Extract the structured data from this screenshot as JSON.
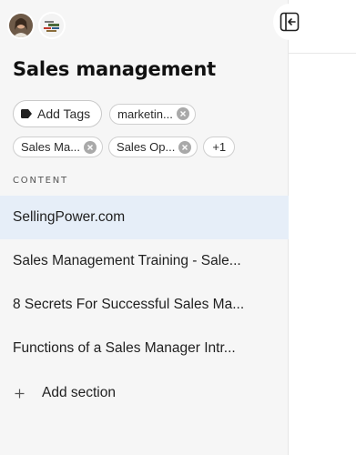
{
  "header": {
    "title": "Sales management"
  },
  "avatars": [
    {
      "icon": "user-avatar"
    },
    {
      "icon": "word-cloud-avatar"
    }
  ],
  "toolbar": {
    "collapse_icon": "collapse-sidebar-icon"
  },
  "tags": {
    "add_label": "Add Tags",
    "items": [
      {
        "label": "marketin..."
      },
      {
        "label": "Sales Ma..."
      },
      {
        "label": "Sales Op..."
      }
    ],
    "more_label": "+1"
  },
  "content": {
    "section_label": "CONTENT",
    "items": [
      {
        "label": "SellingPower.com"
      },
      {
        "label": "Sales Management Training - Sale..."
      },
      {
        "label": "8 Secrets For Successful Sales Ma..."
      },
      {
        "label": "Functions of a Sales Manager Intr..."
      }
    ],
    "add_section_label": "Add section"
  },
  "colors": {
    "sidebar_bg": "#f6f6f6",
    "active_item_bg": "#e6eef8",
    "chip_border": "#cfcfcf"
  }
}
